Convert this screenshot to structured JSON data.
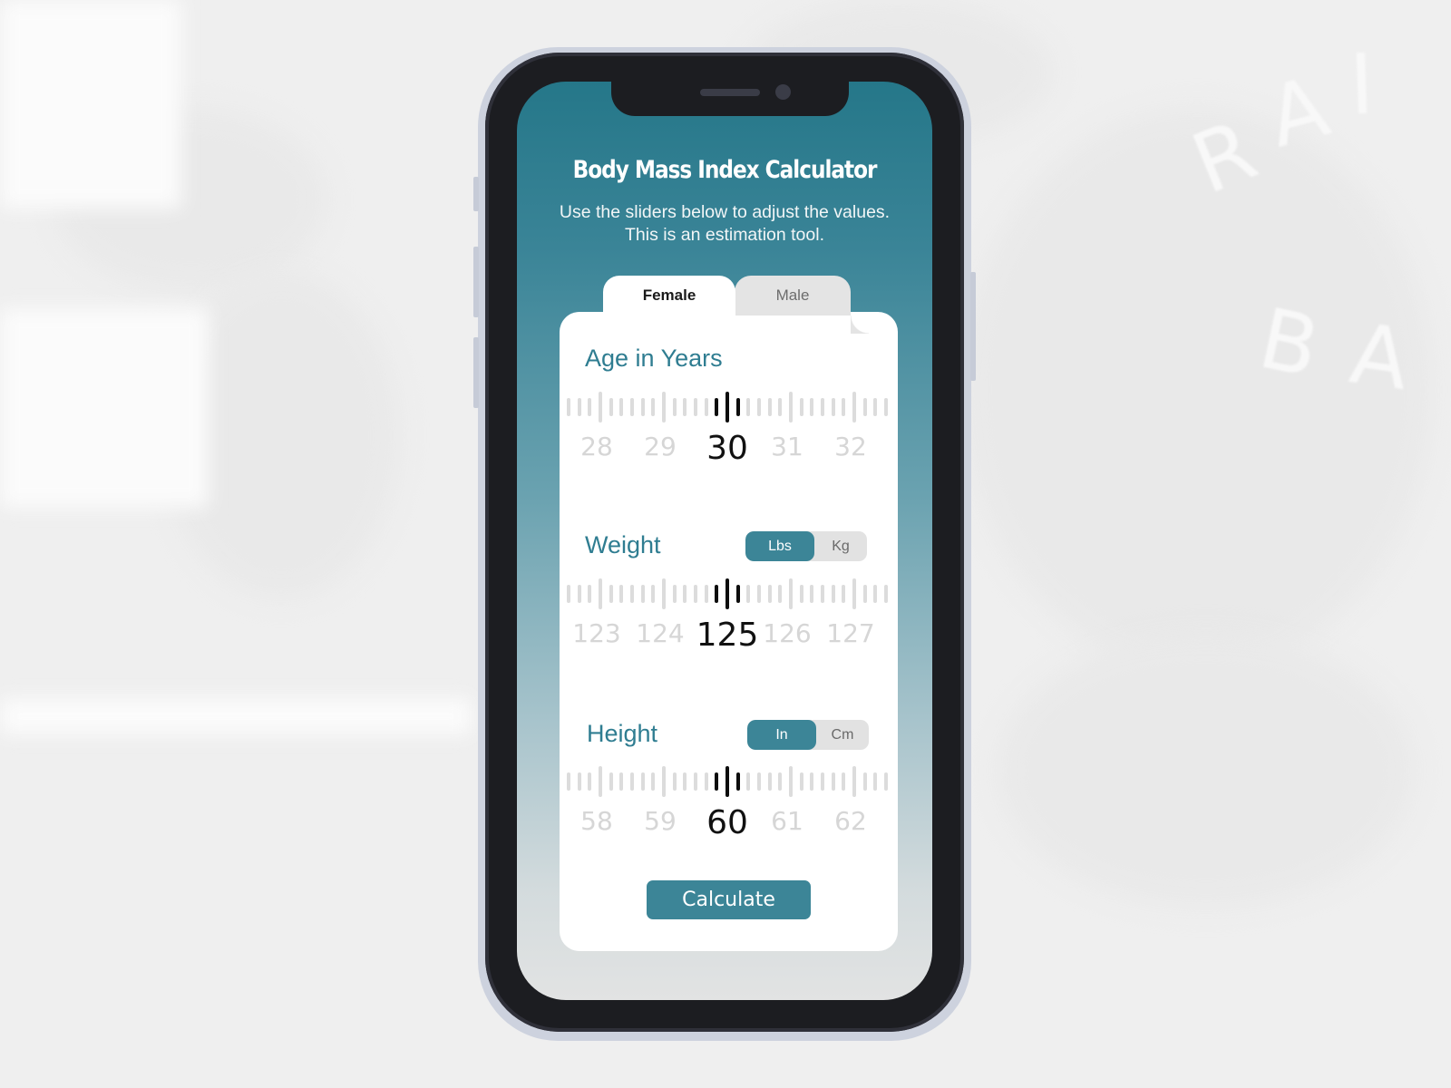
{
  "background": {
    "letters": [
      "R",
      "A",
      "I",
      "B",
      "A"
    ]
  },
  "app": {
    "title": "Body Mass Index Calculator",
    "subtitle_line1": "Use the sliders below to adjust the values.",
    "subtitle_line2": "This is an estimation tool.",
    "accent_color": "#3c8597"
  },
  "tabs": [
    {
      "label": "Female",
      "active": true
    },
    {
      "label": "Male",
      "active": false
    }
  ],
  "sections": [
    {
      "label": "Age in Years",
      "value": 30,
      "ticks": [
        "28",
        "29",
        "30",
        "31",
        "32"
      ],
      "units": null
    },
    {
      "label": "Weight",
      "value": 125,
      "ticks": [
        "123",
        "124",
        "125",
        "126",
        "127"
      ],
      "units": [
        {
          "label": "Lbs",
          "active": true
        },
        {
          "label": "Kg",
          "active": false
        }
      ]
    },
    {
      "label": "Height",
      "value": 60,
      "ticks": [
        "58",
        "59",
        "60",
        "61",
        "62"
      ],
      "units": [
        {
          "label": "In",
          "active": true
        },
        {
          "label": "Cm",
          "active": false
        }
      ]
    }
  ],
  "calculate_label": "Calculate"
}
